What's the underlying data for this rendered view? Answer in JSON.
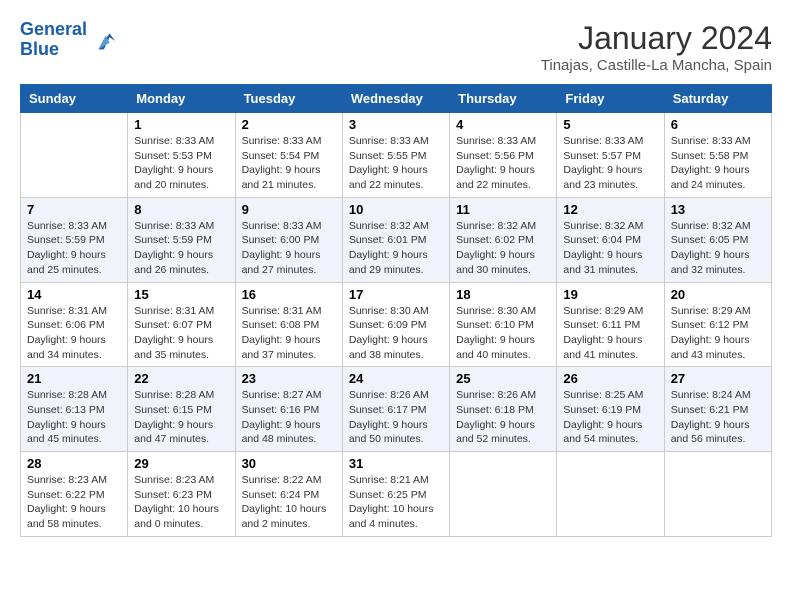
{
  "header": {
    "logo_line1": "General",
    "logo_line2": "Blue",
    "title": "January 2024",
    "subtitle": "Tinajas, Castille-La Mancha, Spain"
  },
  "calendar": {
    "weekdays": [
      "Sunday",
      "Monday",
      "Tuesday",
      "Wednesday",
      "Thursday",
      "Friday",
      "Saturday"
    ],
    "weeks": [
      [
        {
          "day": "",
          "content": ""
        },
        {
          "day": "1",
          "content": "Sunrise: 8:33 AM\nSunset: 5:53 PM\nDaylight: 9 hours\nand 20 minutes."
        },
        {
          "day": "2",
          "content": "Sunrise: 8:33 AM\nSunset: 5:54 PM\nDaylight: 9 hours\nand 21 minutes."
        },
        {
          "day": "3",
          "content": "Sunrise: 8:33 AM\nSunset: 5:55 PM\nDaylight: 9 hours\nand 22 minutes."
        },
        {
          "day": "4",
          "content": "Sunrise: 8:33 AM\nSunset: 5:56 PM\nDaylight: 9 hours\nand 22 minutes."
        },
        {
          "day": "5",
          "content": "Sunrise: 8:33 AM\nSunset: 5:57 PM\nDaylight: 9 hours\nand 23 minutes."
        },
        {
          "day": "6",
          "content": "Sunrise: 8:33 AM\nSunset: 5:58 PM\nDaylight: 9 hours\nand 24 minutes."
        }
      ],
      [
        {
          "day": "7",
          "content": "Sunrise: 8:33 AM\nSunset: 5:59 PM\nDaylight: 9 hours\nand 25 minutes."
        },
        {
          "day": "8",
          "content": "Sunrise: 8:33 AM\nSunset: 5:59 PM\nDaylight: 9 hours\nand 26 minutes."
        },
        {
          "day": "9",
          "content": "Sunrise: 8:33 AM\nSunset: 6:00 PM\nDaylight: 9 hours\nand 27 minutes."
        },
        {
          "day": "10",
          "content": "Sunrise: 8:32 AM\nSunset: 6:01 PM\nDaylight: 9 hours\nand 29 minutes."
        },
        {
          "day": "11",
          "content": "Sunrise: 8:32 AM\nSunset: 6:02 PM\nDaylight: 9 hours\nand 30 minutes."
        },
        {
          "day": "12",
          "content": "Sunrise: 8:32 AM\nSunset: 6:04 PM\nDaylight: 9 hours\nand 31 minutes."
        },
        {
          "day": "13",
          "content": "Sunrise: 8:32 AM\nSunset: 6:05 PM\nDaylight: 9 hours\nand 32 minutes."
        }
      ],
      [
        {
          "day": "14",
          "content": "Sunrise: 8:31 AM\nSunset: 6:06 PM\nDaylight: 9 hours\nand 34 minutes."
        },
        {
          "day": "15",
          "content": "Sunrise: 8:31 AM\nSunset: 6:07 PM\nDaylight: 9 hours\nand 35 minutes."
        },
        {
          "day": "16",
          "content": "Sunrise: 8:31 AM\nSunset: 6:08 PM\nDaylight: 9 hours\nand 37 minutes."
        },
        {
          "day": "17",
          "content": "Sunrise: 8:30 AM\nSunset: 6:09 PM\nDaylight: 9 hours\nand 38 minutes."
        },
        {
          "day": "18",
          "content": "Sunrise: 8:30 AM\nSunset: 6:10 PM\nDaylight: 9 hours\nand 40 minutes."
        },
        {
          "day": "19",
          "content": "Sunrise: 8:29 AM\nSunset: 6:11 PM\nDaylight: 9 hours\nand 41 minutes."
        },
        {
          "day": "20",
          "content": "Sunrise: 8:29 AM\nSunset: 6:12 PM\nDaylight: 9 hours\nand 43 minutes."
        }
      ],
      [
        {
          "day": "21",
          "content": "Sunrise: 8:28 AM\nSunset: 6:13 PM\nDaylight: 9 hours\nand 45 minutes."
        },
        {
          "day": "22",
          "content": "Sunrise: 8:28 AM\nSunset: 6:15 PM\nDaylight: 9 hours\nand 47 minutes."
        },
        {
          "day": "23",
          "content": "Sunrise: 8:27 AM\nSunset: 6:16 PM\nDaylight: 9 hours\nand 48 minutes."
        },
        {
          "day": "24",
          "content": "Sunrise: 8:26 AM\nSunset: 6:17 PM\nDaylight: 9 hours\nand 50 minutes."
        },
        {
          "day": "25",
          "content": "Sunrise: 8:26 AM\nSunset: 6:18 PM\nDaylight: 9 hours\nand 52 minutes."
        },
        {
          "day": "26",
          "content": "Sunrise: 8:25 AM\nSunset: 6:19 PM\nDaylight: 9 hours\nand 54 minutes."
        },
        {
          "day": "27",
          "content": "Sunrise: 8:24 AM\nSunset: 6:21 PM\nDaylight: 9 hours\nand 56 minutes."
        }
      ],
      [
        {
          "day": "28",
          "content": "Sunrise: 8:23 AM\nSunset: 6:22 PM\nDaylight: 9 hours\nand 58 minutes."
        },
        {
          "day": "29",
          "content": "Sunrise: 8:23 AM\nSunset: 6:23 PM\nDaylight: 10 hours\nand 0 minutes."
        },
        {
          "day": "30",
          "content": "Sunrise: 8:22 AM\nSunset: 6:24 PM\nDaylight: 10 hours\nand 2 minutes."
        },
        {
          "day": "31",
          "content": "Sunrise: 8:21 AM\nSunset: 6:25 PM\nDaylight: 10 hours\nand 4 minutes."
        },
        {
          "day": "",
          "content": ""
        },
        {
          "day": "",
          "content": ""
        },
        {
          "day": "",
          "content": ""
        }
      ]
    ]
  }
}
